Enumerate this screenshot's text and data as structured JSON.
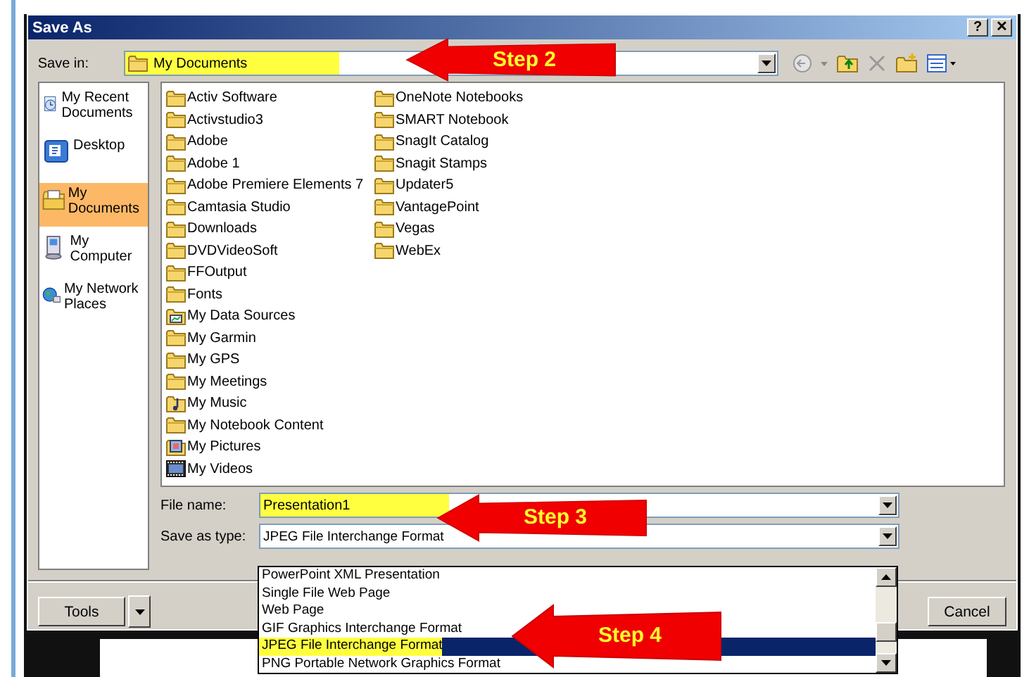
{
  "window": {
    "title": "Save As",
    "title_buttons": [
      "?",
      "✕"
    ]
  },
  "save_in": {
    "label": "Save in:",
    "value": "My Documents",
    "highlighted": true
  },
  "places": [
    {
      "label": "My Recent Documents",
      "kind": "recent",
      "selected": false
    },
    {
      "label": "Desktop",
      "kind": "desktop",
      "selected": false
    },
    {
      "label": "My Documents",
      "kind": "documents",
      "selected": true
    },
    {
      "label": "My Computer",
      "kind": "computer",
      "selected": false
    },
    {
      "label": "My Network Places",
      "kind": "network",
      "selected": false
    }
  ],
  "files": [
    {
      "name": "Activ Software",
      "kind": "folder"
    },
    {
      "name": "Activstudio3",
      "kind": "folder"
    },
    {
      "name": "Adobe",
      "kind": "folder"
    },
    {
      "name": "Adobe 1",
      "kind": "folder"
    },
    {
      "name": "Adobe Premiere Elements 7",
      "kind": "folder"
    },
    {
      "name": "Camtasia Studio",
      "kind": "folder"
    },
    {
      "name": "Downloads",
      "kind": "folder"
    },
    {
      "name": "DVDVideoSoft",
      "kind": "folder"
    },
    {
      "name": "FFOutput",
      "kind": "folder"
    },
    {
      "name": "Fonts",
      "kind": "folder"
    },
    {
      "name": "My Data Sources",
      "kind": "data"
    },
    {
      "name": "My Garmin",
      "kind": "folder"
    },
    {
      "name": "My GPS",
      "kind": "folder"
    },
    {
      "name": "My Meetings",
      "kind": "folder"
    },
    {
      "name": "My Music",
      "kind": "music"
    },
    {
      "name": "My Notebook Content",
      "kind": "folder"
    },
    {
      "name": "My Pictures",
      "kind": "pictures"
    },
    {
      "name": "My Videos",
      "kind": "videos"
    },
    {
      "name": "OneNote Notebooks",
      "kind": "folder"
    },
    {
      "name": "SMART Notebook",
      "kind": "folder"
    },
    {
      "name": "SnagIt Catalog",
      "kind": "folder"
    },
    {
      "name": "Snagit Stamps",
      "kind": "folder"
    },
    {
      "name": "Updater5",
      "kind": "folder"
    },
    {
      "name": "VantagePoint",
      "kind": "folder"
    },
    {
      "name": "Vegas",
      "kind": "folder"
    },
    {
      "name": "WebEx",
      "kind": "folder"
    }
  ],
  "file_name": {
    "label": "File name:",
    "value": "Presentation1",
    "highlighted": true
  },
  "save_as_type": {
    "label": "Save as type:",
    "value": "JPEG File Interchange Format",
    "options": [
      {
        "label": "PowerPoint XML Presentation",
        "selected": false,
        "highlighted": false
      },
      {
        "label": "Single File Web Page",
        "selected": false,
        "highlighted": false
      },
      {
        "label": "Web Page",
        "selected": false,
        "highlighted": false
      },
      {
        "label": "GIF Graphics Interchange Format",
        "selected": false,
        "highlighted": false
      },
      {
        "label": "JPEG File Interchange Format",
        "selected": true,
        "highlighted": true
      },
      {
        "label": "PNG Portable Network Graphics Format",
        "selected": false,
        "highlighted": false
      }
    ]
  },
  "buttons": {
    "tools": "Tools",
    "cancel": "Cancel"
  },
  "annotations": [
    {
      "text": "Step 2"
    },
    {
      "text": "Step 3"
    },
    {
      "text": "Step 4"
    }
  ]
}
